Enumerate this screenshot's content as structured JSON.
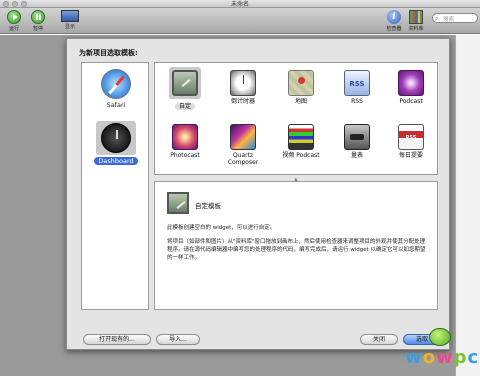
{
  "window": {
    "title": "未命名"
  },
  "toolbar": {
    "items": [
      {
        "label": "运行",
        "icon": "play-icon"
      },
      {
        "label": "暂停",
        "icon": "pause-icon"
      },
      {
        "label": "显示",
        "icon": "display-icon"
      },
      {
        "label": "检查器",
        "icon": "info-icon"
      },
      {
        "label": "资料库",
        "icon": "library-icon"
      }
    ],
    "search_placeholder": "搜索"
  },
  "dialog": {
    "title": "为新项目选取模板:",
    "categories": [
      {
        "label": "Safari",
        "icon": "safari-compass-icon",
        "selected": false
      },
      {
        "label": "Dashboard",
        "icon": "dashboard-icon",
        "selected": true
      }
    ],
    "templates": [
      {
        "label": "自定",
        "icon": "custom-template-icon",
        "selected": true
      },
      {
        "label": "倒计时器",
        "icon": "countdown-timer-icon"
      },
      {
        "label": "地图",
        "icon": "map-icon"
      },
      {
        "label": "RSS",
        "icon": "rss-icon",
        "badge": "RSS"
      },
      {
        "label": "Podcast",
        "icon": "podcast-icon"
      },
      {
        "label": "Photocast",
        "icon": "photocast-icon"
      },
      {
        "label": "Quartz\nComposer",
        "icon": "quartz-composer-icon"
      },
      {
        "label": "视频 Podcast",
        "icon": "video-podcast-icon"
      },
      {
        "label": "量表",
        "icon": "gauge-icon"
      },
      {
        "label": "每日提要",
        "icon": "daily-feed-icon",
        "badge": "RSS"
      }
    ],
    "detail": {
      "name": "自定模板",
      "description_1": "此模板创建空白的 widget，可以进行自定。",
      "description_2": "将项目（如部件和图片）从\"资料库\"窗口拖放到画布上，然后使用检查器来调整项目的外观并使其分配处理程序。请在源代码编辑器中编写您的处理程序的代码，编写完成后，请运行 widget 以确定它可以如您期望的一样工作。"
    },
    "buttons": {
      "open_existing": "打开现有的...",
      "import": "导入...",
      "close": "关闭",
      "choose": "选取"
    }
  },
  "watermark": {
    "text": "wowpc"
  },
  "colors": {
    "selection_blue": "#3b6bd6",
    "primary_button": "#4d8ae6"
  }
}
